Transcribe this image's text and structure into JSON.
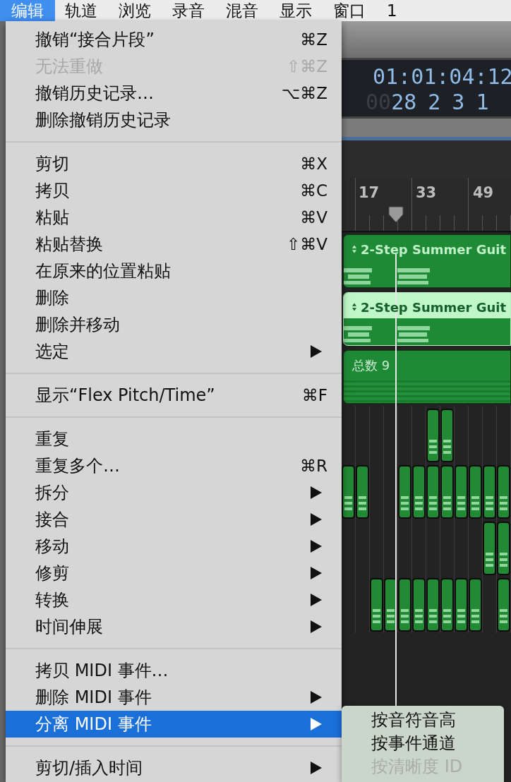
{
  "menu_bar": [
    {
      "label": "编辑",
      "selected": true
    },
    {
      "label": "轨道",
      "selected": false
    },
    {
      "label": "浏览",
      "selected": false
    },
    {
      "label": "录音",
      "selected": false
    },
    {
      "label": "混音",
      "selected": false
    },
    {
      "label": "显示",
      "selected": false
    },
    {
      "label": "窗口",
      "selected": false
    },
    {
      "label": "1",
      "selected": false
    }
  ],
  "edit_menu": {
    "sections": [
      [
        {
          "label": "撤销“接合片段”",
          "shortcut": "⌘Z",
          "disabled": false,
          "submenu": false,
          "selected": false
        },
        {
          "label": "无法重做",
          "shortcut": "⇧⌘Z",
          "disabled": true,
          "submenu": false,
          "selected": false
        },
        {
          "label": "撤销历史记录…",
          "shortcut": "⌥⌘Z",
          "disabled": false,
          "submenu": false,
          "selected": false
        },
        {
          "label": "删除撤销历史记录",
          "disabled": false,
          "submenu": false,
          "selected": false
        }
      ],
      [
        {
          "label": "剪切",
          "shortcut": "⌘X",
          "disabled": false,
          "submenu": false,
          "selected": false
        },
        {
          "label": "拷贝",
          "shortcut": "⌘C",
          "disabled": false,
          "submenu": false,
          "selected": false
        },
        {
          "label": "粘贴",
          "shortcut": "⌘V",
          "disabled": false,
          "submenu": false,
          "selected": false
        },
        {
          "label": "粘贴替换",
          "shortcut": "⇧⌘V",
          "disabled": false,
          "submenu": false,
          "selected": false
        },
        {
          "label": "在原来的位置粘贴",
          "disabled": false,
          "submenu": false,
          "selected": false
        },
        {
          "label": "删除",
          "disabled": false,
          "submenu": false,
          "selected": false
        },
        {
          "label": "删除并移动",
          "disabled": false,
          "submenu": false,
          "selected": false
        },
        {
          "label": "选定",
          "disabled": false,
          "submenu": true,
          "selected": false
        }
      ],
      [
        {
          "label": "显示“Flex Pitch/Time”",
          "shortcut": "⌘F",
          "disabled": false,
          "submenu": false,
          "selected": false
        }
      ],
      [
        {
          "label": "重复",
          "disabled": false,
          "submenu": false,
          "selected": false
        },
        {
          "label": "重复多个…",
          "shortcut": "⌘R",
          "disabled": false,
          "submenu": false,
          "selected": false
        },
        {
          "label": "拆分",
          "disabled": false,
          "submenu": true,
          "selected": false
        },
        {
          "label": "接合",
          "disabled": false,
          "submenu": true,
          "selected": false
        },
        {
          "label": "移动",
          "disabled": false,
          "submenu": true,
          "selected": false
        },
        {
          "label": "修剪",
          "disabled": false,
          "submenu": true,
          "selected": false
        },
        {
          "label": "转换",
          "disabled": false,
          "submenu": true,
          "selected": false
        },
        {
          "label": "时间伸展",
          "disabled": false,
          "submenu": true,
          "selected": false
        }
      ],
      [
        {
          "label": "拷贝 MIDI 事件…",
          "disabled": false,
          "submenu": false,
          "selected": false
        },
        {
          "label": "删除 MIDI 事件",
          "disabled": false,
          "submenu": true,
          "selected": false
        },
        {
          "label": "分离 MIDI 事件",
          "disabled": false,
          "submenu": true,
          "selected": true
        }
      ],
      [
        {
          "label": "剪切/插入时间",
          "disabled": false,
          "submenu": true,
          "selected": false
        }
      ]
    ]
  },
  "submenu": {
    "items": [
      {
        "label": "按音符音高",
        "disabled": false
      },
      {
        "label": "按事件通道",
        "disabled": false
      },
      {
        "label": "按清晰度 ID",
        "disabled": true
      }
    ]
  },
  "lcd": {
    "time": "01:01:04:12",
    "bars_dim": "00",
    "bars": [
      "28",
      "2",
      "3",
      "1"
    ]
  },
  "ruler": {
    "marks": [
      "17",
      "33",
      "49"
    ]
  },
  "tracks": [
    {
      "kind": "region",
      "name": "2-Step Summer Guit",
      "selected": false
    },
    {
      "kind": "region",
      "name": "2-Step Summer Guit",
      "selected": true
    },
    {
      "kind": "folder",
      "name": "总数 9",
      "selected": false
    }
  ]
}
